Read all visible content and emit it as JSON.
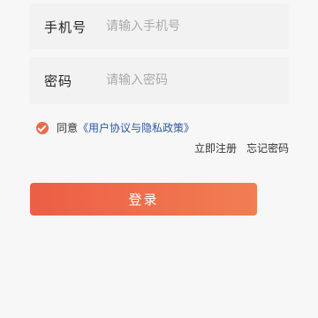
{
  "form": {
    "phone": {
      "label": "手机号",
      "placeholder": "请输入手机号",
      "value": ""
    },
    "password": {
      "label": "密码",
      "placeholder": "请输入密码",
      "value": ""
    }
  },
  "agreement": {
    "checked": true,
    "prefix": "同意",
    "link": "《用户协议与隐私政策》"
  },
  "links": {
    "register": "立即注册",
    "forgot": "忘记密码"
  },
  "login_button": "登录",
  "colors": {
    "accent": "#ec6a4a",
    "link": "#2a56a8",
    "button_start": "#ec5e45",
    "button_end": "#f27e52"
  }
}
